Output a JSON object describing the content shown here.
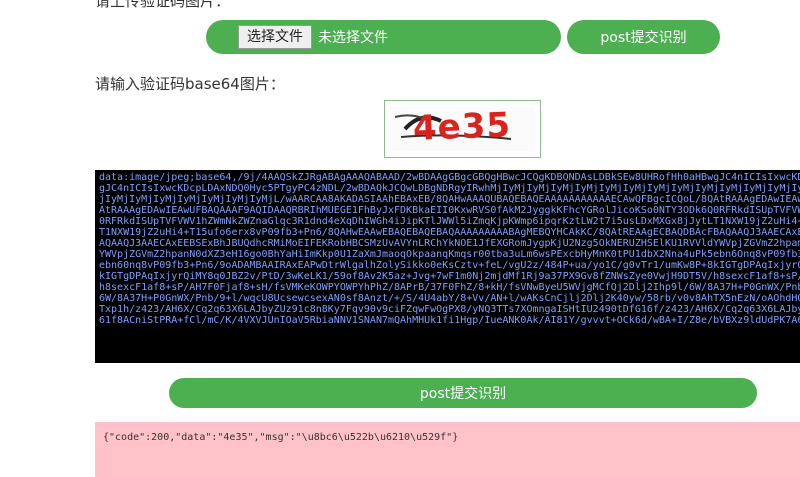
{
  "upload": {
    "title": "请上传验证码图片：",
    "file_button_label": "选择文件",
    "file_status": "未选择文件",
    "submit_label": "post提交识别"
  },
  "base64": {
    "label": "请输入验证码base64图片：",
    "captcha_text": "4e35",
    "textarea_lines": [
      "data:image/jpeg;base64,/9j/4AAQSkZJRgABAgAAAQABAAD/2wBDAAgGBgcGBQgHBwcJCQgKDBQNDAsLDBkSEw8UHRofHh0aHBwgJC4nICIsIxwcKDcpLDAxNDQ0Hyc5PTgyPC4zNDL/2wBDAQkJCQwLDBgNDRgyIRwhMjIy",
      "gJC4nICIsIxwcKDcpLDAxNDQ0Hyc5PTgyPC4zNDL/2wBDAQkJCQwLDBgNDRgyIRwhMjIyMjIyMjIyMjIyMjIyMjIyMjIyMjIyMjIyMjIyMjIyMjIyMjIyMjIyMjIyMjIyMjIyMjIyMjIy",
      "jIyMjIyMjIyMjIyMjIyMjIyMjIyMjL/wAARCAA8AKADASIAAhEBAxEB/8QAHwAAAQUBAQEBAQEAAAAAAAAAAAECAwQFBgcICQoL/8QAtRAAAgEDAwIEAwUFBAQAAAF9AQIDAAQRBRIhMUEGE1FhByJxFDKB",
      "AtRAAAgEDAwIEAwUFBAQAAAF9AQIDAAQRBRIhMUEGE1FhByJxFDKBkaEII0KxwRVS0fAkM2JyggkKFhcYGRolJicoKSo0NTY3ODk6Q0RFRkdISUpTVFVWV1hZWmNkZWZnaGlqc3R1dnd4eXqDhIWGh4iJipKTlJWW",
      "0RFRkdISUpTVFVWV1hZWmNkZWZnaGlqc3R1dnd4eXqDhIWGh4iJipKTlJWWl5iZmqKjpKWmp6ipqrKztLW2t7i5usLDxMXGx8jJytLT1NXW19jZ2uHi4+Tl5ufo6erx8vP09fb3+Pn6/8QAHwEAAwEBAQEB",
      "T1NXW19jZ2uHi4+T15ufo6erx8vP09fb3+Pn6/8QAHwEAAwEBAQEBAQEBAQAAAAAAAAABAgMEBQYHCAkKC/8QAtREAAgECBAQDBAcFBAQAAQJ3AAECAxEEBSExBhJBUQdhcRMiMoEIFEKRobHBCSMzUvAV",
      "AQAAQJ3AAECAxEEBSExBhJBUQdhcRMiMoEIFEKRobHBCSMzUvAVYnLRChYkNOE1JfEXGRomJygpKjU2Nzg5OkNERUZHSElKU1RVVldYWVpjZGVmZ2hpamNzdHV2d3h5eoKDhIWGh4iJipKTlJWWl5iZmqKj",
      "YWVpjZGVmZ2hpanN0dXZ3eH16go0BhYaHiImKkp0U1ZaXmJmaoqOkpaanqKmqsr00tba3uLm6wsPExcbHyMnK0tPU1dbX2Nna4uPk5ebn6Onq8vP09fb3+Pn6/9oADAMBAAIRAxEAPwDtrWlgalhZo1ySikko",
      "ebn60nq8vP09fb3+Pn6/9oADAMBAAIRAxEAPwDtrWlgalhZolySikko0eKsCztv+feL/vgU2z/484P+ua/yo1C/g0vTr1/umKw8P+8kIGTgDPAqIxjyrQiMY8q0JBZ2v/PtD/3wKeLK1/59of8Av2K5z",
      "kIGTgDPAqIxjyrQiMY8q0JBZ2v/PtD/3wKeLK1/59of8Av2K5az+Jvg+7wF1m0Nj2mjdMf1Rj9a37PX9Gv8fZNWsZye0VwjH9DT5V/h8sexcF1af8+sP/AH7F0Fjaf8+sH/fsVMKeKOWPYOWPYhPhZ/8APrB/",
      "h8sexcF1af8+sP/AH7F0Fjaf8+sH/fsVMKeKOWPYOWPYhPhZ/8APrB/37F0FhZ/8+kH/fsVNwByeU5WVjgMCfQj2Dlj2Ihp9l/6W/8A37H+P0GnWX/Pnb/9+l/wqcU8UcsewcsexAN0sf8Anzt/+/S/4U4abY",
      "6W/8A37H+P0GnWX/Pnb/9+l/wqcU8UcsewcsexAN0sf8Anzt/+/S/4U4abY/8+Vv/AN+l/wAKsCnCjlj2Dlj2K40yw/58rb/v0v8AhTX5nEzN/oAOhdHQ2UQP+RPcc",
      "Txp1h/z423/AH6X/Cq2q63X6LAJbyZUz91c8n8Ky7Fqv90v9ciFZqwFwOgPX8/yNQ3TTs7XOmngaISHtIU2490tDfG16f/z423/AH6X/Cq2q63X6LAJbyZUz91c8n8K",
      "61f8ACniStPRA+fCl/mC/K/4VXVJUnIOaV5RbiaNNV1SNAN7mQAhMHUk1fi1Hgp/IueANK0Ak/AI81Y/gvvvt+OCk6d/wBA+I/Z8e/bVBXz9ldUdPK7A6oBf2ebVkT"
    ]
  },
  "submit_bottom_label": "post提交识别",
  "result": {
    "text": "{\"code\":200,\"data\":\"4e35\",\"msg\":\"\\u8bc6\\u522b\\u6210\\u529f\"}"
  },
  "colors": {
    "accent_green": "#4caf50",
    "result_background": "#ffc2c8",
    "textarea_background": "#000000",
    "textarea_text": "#7da0ff",
    "captcha_text": "#d9241d"
  }
}
